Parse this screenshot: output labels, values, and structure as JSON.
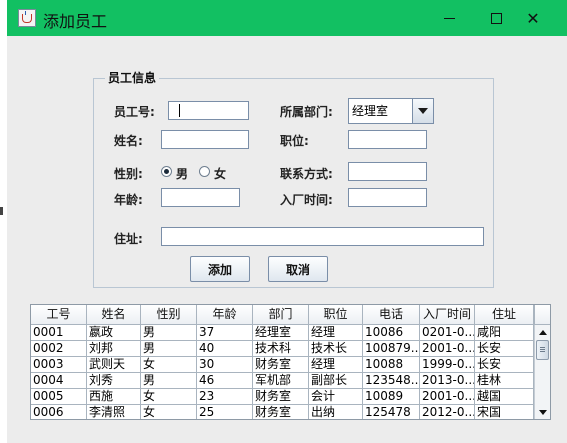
{
  "window": {
    "title": "添加员工",
    "icon": "java-cup-icon",
    "title_bar_color": "#12c062",
    "controls": {
      "minimize": "minimize-icon",
      "maximize": "maximize-icon",
      "close": "✕"
    }
  },
  "form": {
    "group_title": "员工信息",
    "labels": {
      "id": "员工号:",
      "dept": "所属部门:",
      "name": "姓名:",
      "position": "职位:",
      "gender": "性别:",
      "contact": "联系方式:",
      "age": "年龄:",
      "hire_date": "入厂时间:",
      "address": "住址:"
    },
    "values": {
      "id": "",
      "name": "",
      "position": "",
      "contact": "",
      "age": "",
      "hire_date": "",
      "address": ""
    },
    "dept_selected": "经理室",
    "gender_options": [
      "男",
      "女"
    ],
    "gender_selected": "男",
    "add_button": "添加",
    "cancel_button": "取消"
  },
  "table": {
    "columns": [
      "工号",
      "姓名",
      "性别",
      "年龄",
      "部门",
      "职位",
      "电话",
      "入厂时间",
      "住址"
    ],
    "rows": [
      [
        "0001",
        "嬴政",
        "男",
        "37",
        "经理室",
        "经理",
        "10086",
        "0201-0...",
        "咸阳"
      ],
      [
        "0002",
        "刘邦",
        "男",
        "40",
        "技术科",
        "技术长",
        "100879...",
        "2001-0...",
        "长安"
      ],
      [
        "0003",
        "武则天",
        "女",
        "30",
        "财务室",
        "经理",
        "10088",
        "1999-0...",
        "长安"
      ],
      [
        "0004",
        "刘秀",
        "男",
        "46",
        "军机部",
        "副部长",
        "123548...",
        "2013-0...",
        "桂林"
      ],
      [
        "0005",
        "西施",
        "女",
        "23",
        "财务室",
        "会计",
        "10089",
        "2001-0...",
        "越国"
      ],
      [
        "0006",
        "李清照",
        "女",
        "25",
        "财务室",
        "出纳",
        "125478",
        "2012-0...",
        "宋国"
      ]
    ],
    "scroll_up_icon": "scroll-up-icon",
    "scroll_down_icon": "scroll-down-icon"
  }
}
